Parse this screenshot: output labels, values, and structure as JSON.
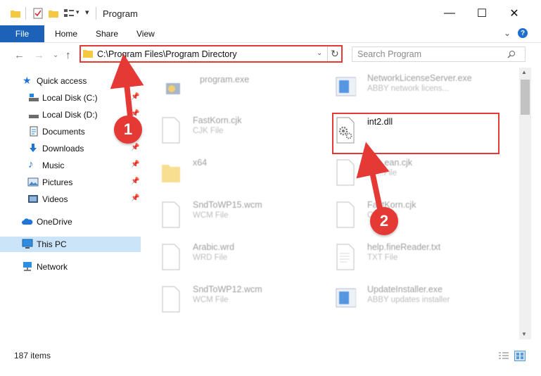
{
  "window": {
    "title": "Program",
    "minimize_glyph": "—",
    "maximize_glyph": "☐",
    "close_glyph": "✕"
  },
  "ribbon": {
    "tabs": [
      "File",
      "Home",
      "Share",
      "View"
    ],
    "help_glyph": "?"
  },
  "nav": {
    "address": "C:\\Program Files\\Program Directory",
    "search_placeholder": "Search Program"
  },
  "sidebar": {
    "items": [
      {
        "label": "Quick access",
        "icon": "star-icon",
        "pinned": false
      },
      {
        "label": "Local Disk (C:)",
        "icon": "drive-icon",
        "pinned": true
      },
      {
        "label": "Local Disk (D:)",
        "icon": "drive-icon",
        "pinned": true
      },
      {
        "label": "Documents",
        "icon": "documents-icon",
        "pinned": true
      },
      {
        "label": "Downloads",
        "icon": "download-icon",
        "pinned": true
      },
      {
        "label": "Music",
        "icon": "music-icon",
        "pinned": true
      },
      {
        "label": "Pictures",
        "icon": "pictures-icon",
        "pinned": true
      },
      {
        "label": "Videos",
        "icon": "videos-icon",
        "pinned": true
      },
      {
        "label": "OneDrive",
        "icon": "cloud-icon",
        "pinned": false
      },
      {
        "label": "This PC",
        "icon": "computer-icon",
        "pinned": false
      },
      {
        "label": "Network",
        "icon": "network-icon",
        "pinned": false
      }
    ],
    "selected": "This PC"
  },
  "files": [
    {
      "name": "program.exe",
      "type": ""
    },
    {
      "name": "NetworkLicenseServer.exe",
      "type": "ABBY network licens..."
    },
    {
      "name": "FastKorn.cjk",
      "type": "CJK File"
    },
    {
      "name": "int2.dll",
      "type": ""
    },
    {
      "name": "x64",
      "type": ""
    },
    {
      "name": "...ean.cjk",
      "type": "...File"
    },
    {
      "name": "SndToWP15.wcm",
      "type": "WCM File"
    },
    {
      "name": "FastKorn.cjk",
      "type": "CJK File"
    },
    {
      "name": "Arabic.wrd",
      "type": "WRD File"
    },
    {
      "name": "help.fineReader.txt",
      "type": "TXT File"
    },
    {
      "name": "SndToWP12.wcm",
      "type": "WCM File"
    },
    {
      "name": "UpdateInstaller.exe",
      "type": "ABBY updates installer"
    }
  ],
  "status": {
    "item_count": "187 items"
  },
  "annotations": {
    "step1": "1",
    "step2": "2",
    "arrow_color": "#e53935"
  }
}
